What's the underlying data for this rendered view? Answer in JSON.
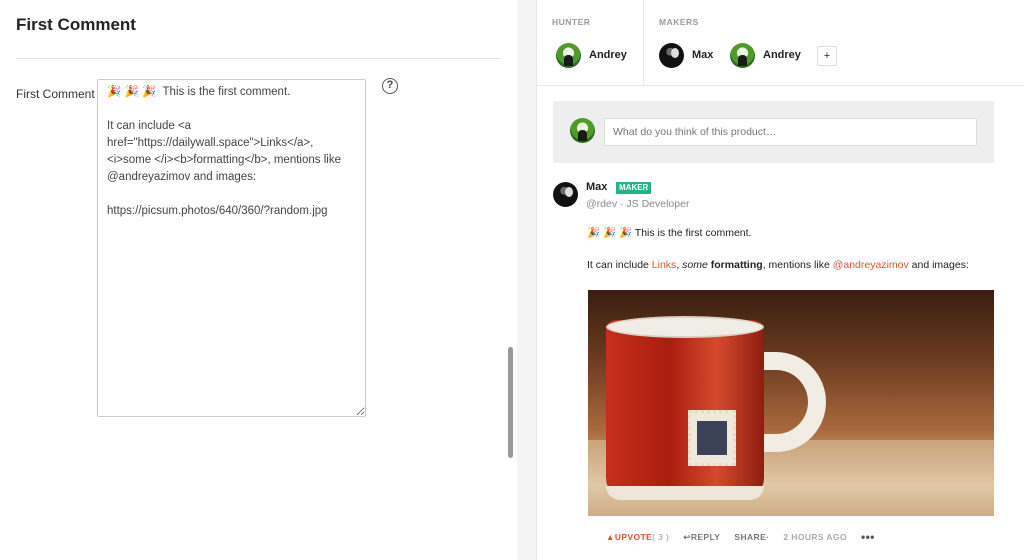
{
  "editor": {
    "title": "First Comment",
    "field_label": "First Comment",
    "textarea_value": "🎉 🎉 🎉  This is the first comment.\n\nIt can include <a href=\"https://dailywall.space\">Links</a>, <i>some </i><b>formatting</b>, mentions like @andreyazimov and images:\n\nhttps://picsum.photos/640/360/?random.jpg",
    "help_icon": "?"
  },
  "preview": {
    "hunter_header": "HUNTER",
    "makers_header": "MAKERS",
    "hunter": {
      "name": "Andrey",
      "avatar": "green-avatar"
    },
    "makers": [
      {
        "name": "Max",
        "avatar": "dark-avatar"
      },
      {
        "name": "Andrey",
        "avatar": "green-avatar"
      }
    ],
    "add_label": "+",
    "composer_placeholder": "What do you think of this product…",
    "comment": {
      "author": "Max",
      "badge": "MAKER",
      "handle": "@rdev · JS Developer",
      "line1": "🎉 🎉 🎉  This is the first comment.",
      "line2_prefix": "It can include ",
      "link_text": "Links",
      "line2_sep": ", ",
      "italic_text": "some",
      "space": " ",
      "bold_text": "formatting",
      "line2_mid": ", mentions like ",
      "mention": "@andreyazimov",
      "line2_suffix": " and images:"
    },
    "actions": {
      "upvote": "▲UPVOTE",
      "upvote_count": "( 3 )",
      "reply": "↩REPLY",
      "share": "SHARE·",
      "time": "2 HOURS AGO",
      "more": "•••"
    }
  },
  "colors": {
    "accent": "#da552f",
    "maker_badge": "#21b581"
  }
}
